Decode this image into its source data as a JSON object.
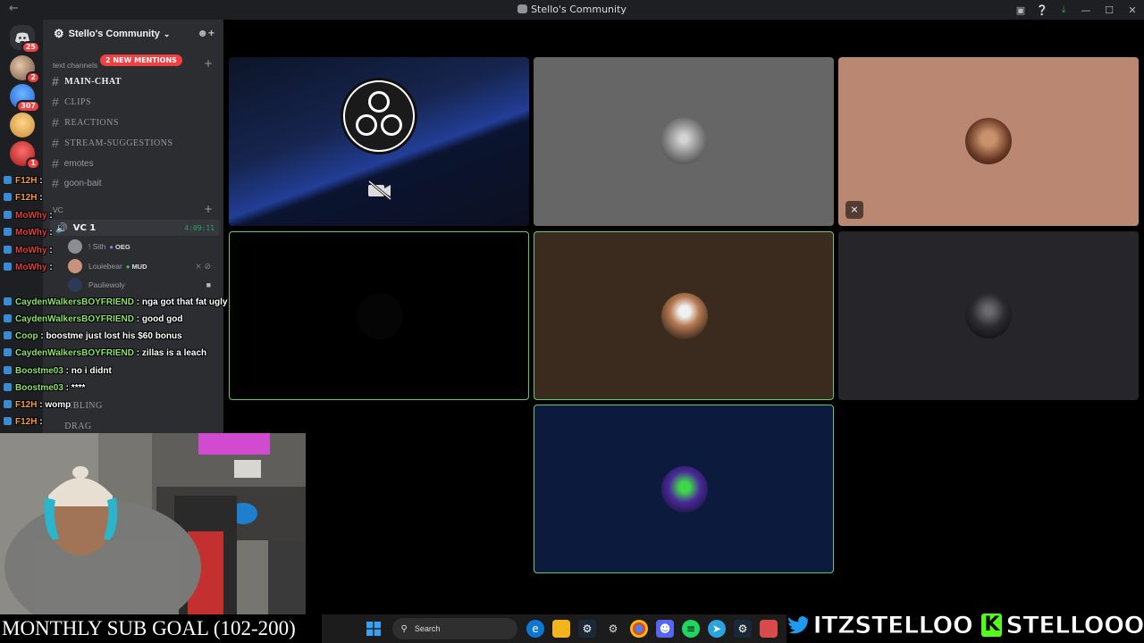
{
  "window": {
    "title": "Stello's Community"
  },
  "servers": [
    {
      "badge": "25"
    },
    {
      "badge": "2"
    },
    {
      "badge": "307"
    },
    {
      "badge": ""
    },
    {
      "badge": "1"
    }
  ],
  "sidebar": {
    "server_name": "Stello's Community",
    "mentions_pill": "2 NEW MENTIONS",
    "text_category": "text channels",
    "channels": [
      {
        "name": "MAIN-CHAT"
      },
      {
        "name": "CLIPS"
      },
      {
        "name": "REACTIONS"
      },
      {
        "name": "STREAM-SUGGESTIONS"
      },
      {
        "name": "emotes"
      },
      {
        "name": "goon-bait"
      }
    ],
    "voice_category": "VC",
    "voice_channel": {
      "name": "VC 1",
      "timer": "4:09:11"
    },
    "members": [
      {
        "name": "! Sith",
        "tag": "OEG"
      },
      {
        "name": "Louiebear",
        "tag": "MUD"
      },
      {
        "name": "Pauliewoly",
        "tag": ""
      }
    ],
    "lower_channels": [
      {
        "name": "MBLING"
      },
      {
        "name": "DRAG"
      }
    ]
  },
  "chat": [
    {
      "user": "F12H",
      "msg": "",
      "color": "#f39c3d"
    },
    {
      "user": "F12H",
      "msg": "",
      "color": "#f39c3d"
    },
    {
      "user": "MoWhy",
      "msg": "",
      "color": "#e0413a"
    },
    {
      "user": "MoWhy",
      "msg": "",
      "color": "#e0413a"
    },
    {
      "user": "MoWhy",
      "msg": "",
      "color": "#e0413a"
    },
    {
      "user": "MoWhy",
      "msg": "",
      "color": "#e0413a"
    },
    {
      "user": "CaydenWalkersBOYFRIEND",
      "msg": "nga got that fat ugly monster zillas in call",
      "color": "#8ee26b"
    },
    {
      "user": "CaydenWalkersBOYFRIEND",
      "msg": "good god",
      "color": "#8ee26b"
    },
    {
      "user": "Coop",
      "msg": "boostme just lost his $60 bonus",
      "color": "#8ee26b"
    },
    {
      "user": "CaydenWalkersBOYFRIEND",
      "msg": "zillas is a leach",
      "color": "#8ee26b"
    },
    {
      "user": "Boostme03",
      "msg": "no i didnt",
      "color": "#8ee26b"
    },
    {
      "user": "Boostme03",
      "msg": "****",
      "color": "#8ee26b"
    },
    {
      "user": "F12H",
      "msg": "womp",
      "color": "#f39c3d"
    },
    {
      "user": "F12H",
      "msg": "",
      "color": "#f39c3d"
    }
  ],
  "overlay": {
    "subgoal": "MONTHLY SUB GOAL (102-200)",
    "twitter": "ITZSTELLOO",
    "kick": "STELLOOO"
  },
  "taskbar": {
    "search_placeholder": "Search"
  }
}
